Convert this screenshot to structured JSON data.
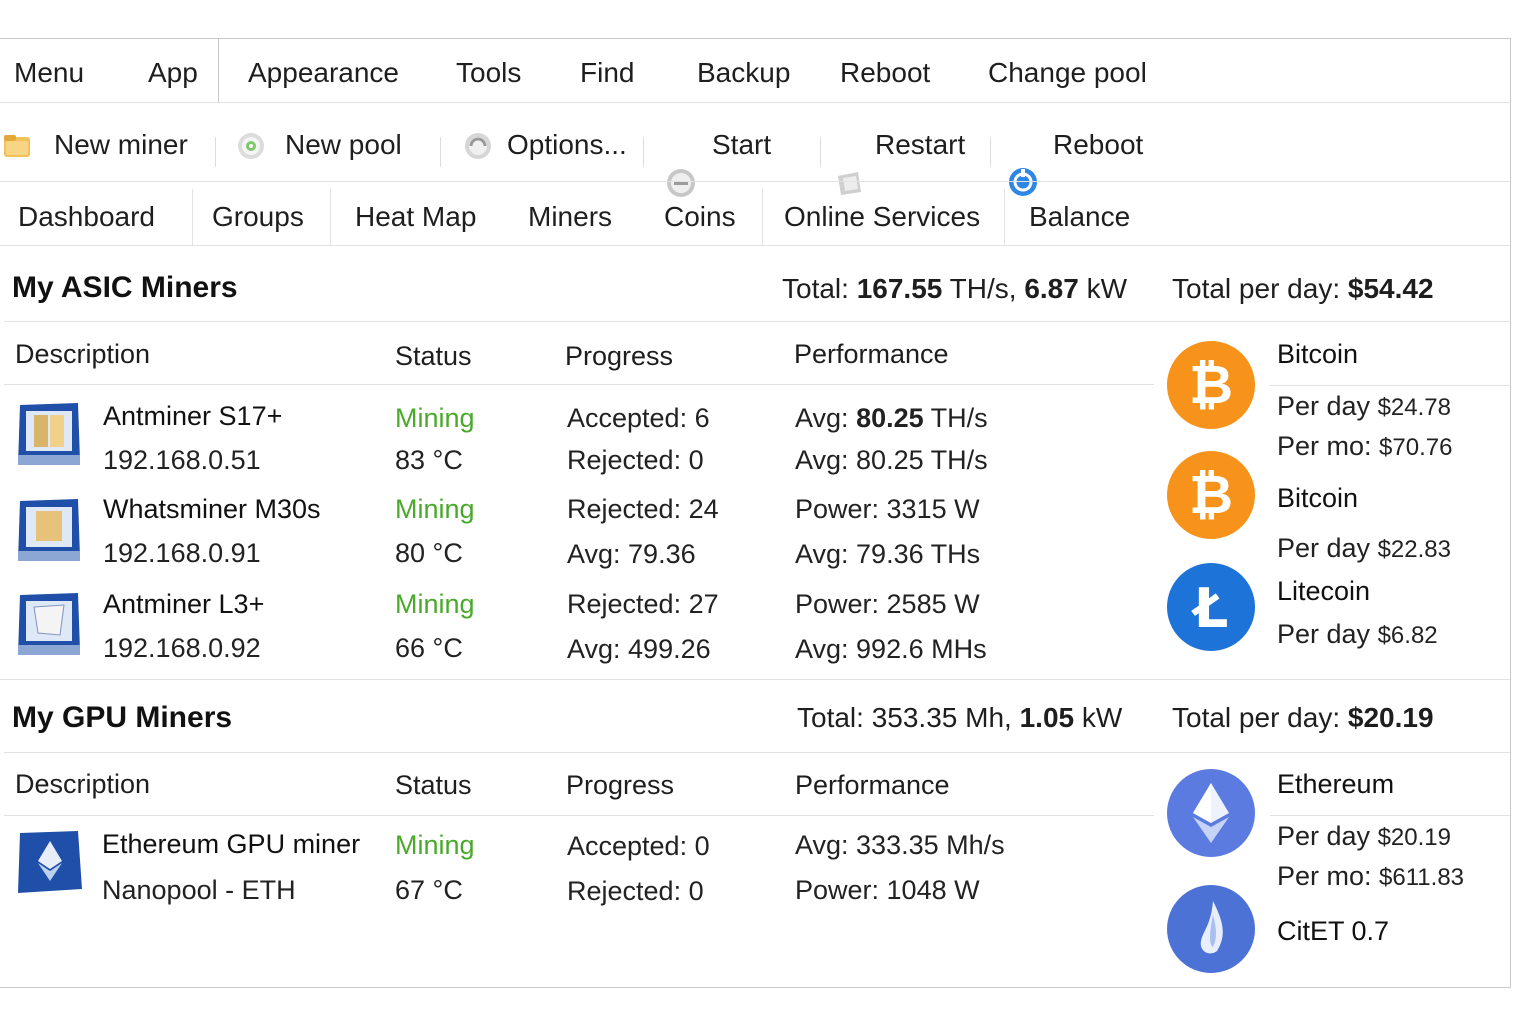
{
  "menu": {
    "items": [
      "Menu",
      "App",
      "Appearance",
      "Tools",
      "Find",
      "Backup",
      "Reboot",
      "Change pool"
    ]
  },
  "toolbar": {
    "new_miner": {
      "label": "New miner",
      "icon": "folder-icon"
    },
    "new_pool": {
      "label": "New pool",
      "icon": "pool-icon"
    },
    "options": {
      "label": "Options...",
      "icon": "options-icon"
    },
    "start": {
      "label": "Start",
      "icon": "start-icon"
    },
    "restart": {
      "label": "Restart",
      "icon": "restart-icon"
    },
    "reboot": {
      "label": "Reboot",
      "icon": "reboot-icon"
    }
  },
  "tabs": [
    "Dashboard",
    "Groups",
    "Heat Map",
    "Miners",
    "Coins",
    "Online Services",
    "Balance"
  ],
  "columns": {
    "description": "Description",
    "status": "Status",
    "progress": "Progress",
    "performance": "Performance"
  },
  "asic": {
    "title": "My ASIC Miners",
    "total_label": "Total:",
    "total_hash": "167.55",
    "total_hash_unit": "TH/s,",
    "total_power": "6.87",
    "total_power_unit": "kW",
    "per_day_label": "Total per day:",
    "per_day_value": "$54.42",
    "miners": [
      {
        "name": "Antminer S17+",
        "ip": "192.168.0.51",
        "status": "Mining",
        "temp": "83 °C",
        "progress1": "Accepted: 6",
        "progress2": "Rejected: 0",
        "perf1_label": "Avg:",
        "perf1_value": "80.25",
        "perf1_unit": "TH/s",
        "perf2": "Avg: 80.25 TH/s"
      },
      {
        "name": "Whatsminer M30s",
        "ip": "192.168.0.91",
        "status": "Mining",
        "temp": "80 °C",
        "progress1": "Rejected: 24",
        "progress2": "Avg: 79.36",
        "perf1": "Power: 3315 W",
        "perf2": "Avg: 79.36 THs"
      },
      {
        "name": "Antminer L3+",
        "ip": "192.168.0.92",
        "status": "Mining",
        "temp": "66 °C",
        "progress1": "Rejected: 27",
        "progress2": "Avg: 499.26",
        "perf1": "Power: 2585 W",
        "perf2": "Avg: 992.6 MHs"
      }
    ],
    "coins": [
      {
        "name": "Bitcoin",
        "per_day_label": "Per day",
        "per_day": "$24.78",
        "per_mo_label": "Per mo:",
        "per_mo": "$70.76",
        "icon": "bitcoin-icon",
        "color": "#f7931a"
      },
      {
        "name": "Bitcoin",
        "per_day_label": "Per day",
        "per_day": "$22.83",
        "icon": "bitcoin-icon",
        "color": "#f7931a"
      },
      {
        "name": "Litecoin",
        "per_day_label": "Per day",
        "per_day": "$6.82",
        "icon": "litecoin-icon",
        "color": "#1e73d8"
      }
    ]
  },
  "gpu": {
    "title": "My GPU Miners",
    "total_label": "Total:",
    "total_hash": "353.35 Mh,",
    "total_power": "1.05",
    "total_power_unit": "kW",
    "per_day_label": "Total per day:",
    "per_day_value": "$20.19",
    "miners": [
      {
        "name": "Ethereum GPU miner",
        "pool": "Nanopool - ETH",
        "status": "Mining",
        "temp": "67 °C",
        "progress1": "Accepted: 0",
        "progress2": "Rejected: 0",
        "perf1": "Avg: 333.35 Mh/s",
        "perf2": "Power: 1048 W"
      }
    ],
    "coins": [
      {
        "name": "Ethereum",
        "per_day_label": "Per day",
        "per_day": "$20.19",
        "per_mo_label": "Per mo:",
        "per_mo": "$611.83",
        "icon": "ethereum-icon",
        "color": "#5b7be0"
      },
      {
        "name": "CitET 0.7",
        "icon": "citet-icon",
        "color": "#4d72d6"
      }
    ]
  }
}
